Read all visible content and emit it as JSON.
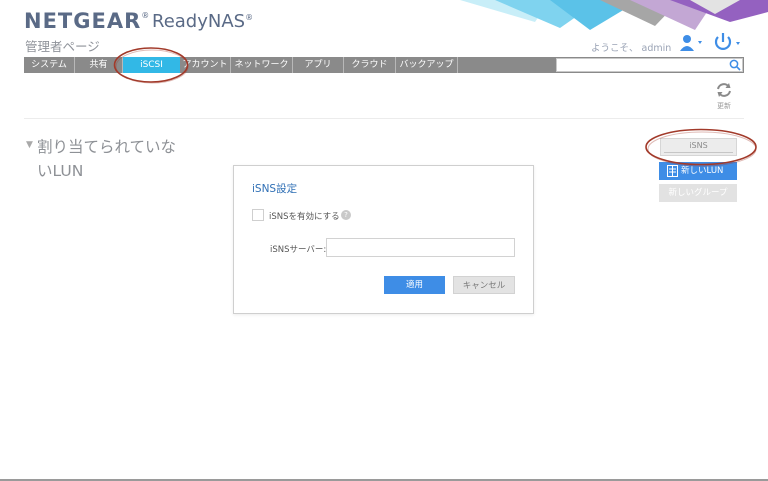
{
  "header": {
    "brand": "NETGEAR",
    "brand_mark": "®",
    "product": "ReadyNAS",
    "product_mark": "®",
    "subtitle": "管理者ページ",
    "welcome": "ようこそ、 admin",
    "icons": [
      "user-icon",
      "power-icon"
    ]
  },
  "nav": {
    "items": [
      {
        "label": "システム"
      },
      {
        "label": "共有"
      },
      {
        "label": "iSCSI",
        "active": true
      },
      {
        "label": "アカウント"
      },
      {
        "label": "ネットワーク"
      },
      {
        "label": "アプリ"
      },
      {
        "label": "クラウド"
      },
      {
        "label": "バックアップ"
      }
    ],
    "search_placeholder": "",
    "search_icon": "search-icon"
  },
  "toolbar": {
    "refresh_label": "更新",
    "refresh_icon": "refresh-icon"
  },
  "section": {
    "title": "割り当てられていないLUN"
  },
  "side_buttons": {
    "isns": "iSNS",
    "new_lun": "新しいLUN",
    "new_group": "新しいグループ"
  },
  "dialog": {
    "title": "iSNS設定",
    "enable_label": "iSNSを有効にする",
    "help": "?",
    "server_label": "iSNSサーバー:",
    "server_value": "",
    "apply": "適用",
    "cancel": "キャンセル"
  },
  "colors": {
    "brand": "#5a6a86",
    "nav_bg": "#8a8a8a",
    "nav_active": "#32b8e6",
    "primary_button": "#3e8de6",
    "annotation_ring": "#a23a2a"
  }
}
